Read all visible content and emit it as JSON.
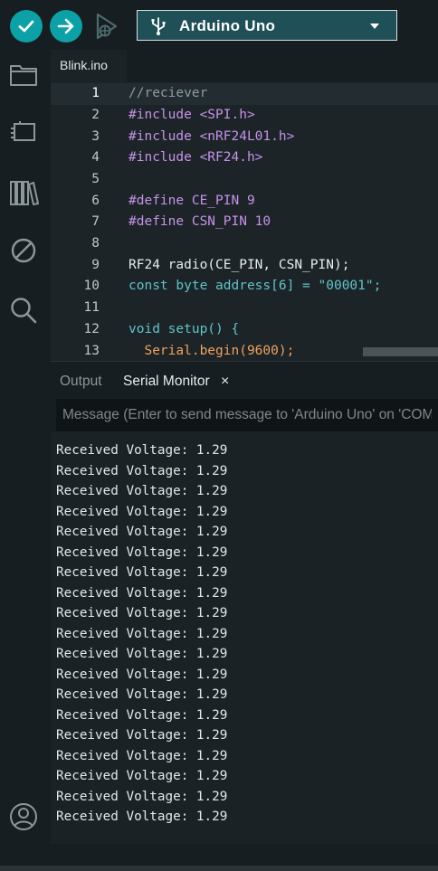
{
  "toolbar": {
    "verify_icon": "check-icon",
    "upload_icon": "arrow-right-icon",
    "debug_icon": "debug-icon",
    "board_label": "Arduino Uno",
    "board_icon": "usb-icon"
  },
  "sidebar": {
    "items": [
      "folder-icon",
      "board-manager-icon",
      "library-icon",
      "debug-disabled-icon",
      "search-icon",
      "account-icon"
    ]
  },
  "tabs": {
    "file_tab_label": "Blink.ino"
  },
  "editor": {
    "current_line": 1,
    "lines": [
      {
        "num": "1",
        "text": "//reciever"
      },
      {
        "num": "2",
        "text": "#include <SPI.h>"
      },
      {
        "num": "3",
        "text": "#include <nRF24L01.h>"
      },
      {
        "num": "4",
        "text": "#include <RF24.h>"
      },
      {
        "num": "5",
        "text": ""
      },
      {
        "num": "6",
        "text": "#define CE_PIN 9"
      },
      {
        "num": "7",
        "text": "#define CSN_PIN 10"
      },
      {
        "num": "8",
        "text": ""
      },
      {
        "num": "9",
        "text": "RF24 radio(CE_PIN, CSN_PIN);"
      },
      {
        "num": "10",
        "text": "const byte address[6] = \"00001\";"
      },
      {
        "num": "11",
        "text": ""
      },
      {
        "num": "12",
        "text": "void setup() {"
      },
      {
        "num": "13",
        "text": "  Serial.begin(9600);"
      }
    ]
  },
  "panel": {
    "output_tab": "Output",
    "serial_tab": "Serial Monitor",
    "close_glyph": "×",
    "message_placeholder": "Message (Enter to send message to 'Arduino Uno' on 'COM"
  },
  "serial_lines": [
    "Received Voltage: 1.29",
    "Received Voltage: 1.29",
    "Received Voltage: 1.29",
    "Received Voltage: 1.29",
    "Received Voltage: 1.29",
    "Received Voltage: 1.29",
    "Received Voltage: 1.29",
    "Received Voltage: 1.29",
    "Received Voltage: 1.29",
    "Received Voltage: 1.29",
    "Received Voltage: 1.29",
    "Received Voltage: 1.29",
    "Received Voltage: 1.29",
    "Received Voltage: 1.29",
    "Received Voltage: 1.29",
    "Received Voltage: 1.29",
    "Received Voltage: 1.29",
    "Received Voltage: 1.29",
    "Received Voltage: 1.29"
  ],
  "colors": {
    "accent": "#0ca1a6",
    "background": "#171e21",
    "editor_bg": "#1c2428"
  }
}
